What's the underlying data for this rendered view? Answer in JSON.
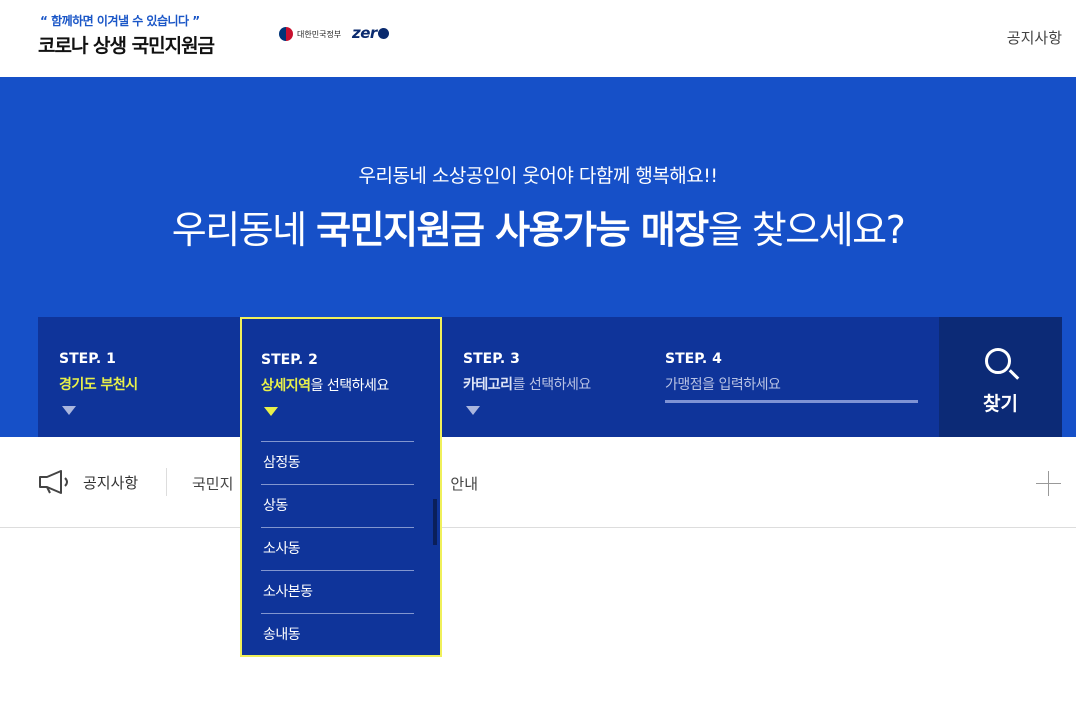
{
  "header": {
    "slogan": "“ 함께하면 이겨낼 수 있습니다 ”",
    "site_title": "코로나 상생 국민지원금",
    "gov_label": "대한민국정부",
    "zero_label": "zer",
    "notice_link": "공지사항"
  },
  "hero": {
    "subtitle": "우리동네 소상공인이 웃어야 다함께 행복해요!!",
    "title_prefix": "우리동네 ",
    "title_bold": "국민지원금 사용가능 매장",
    "title_suffix": "을 찾으세요?"
  },
  "search": {
    "step1": {
      "label": "STEP. 1",
      "value": "경기도 부천시"
    },
    "step2": {
      "label": "STEP. 2",
      "value_highlight": "상세지역",
      "value_rest": "을 선택하세요"
    },
    "step3": {
      "label": "STEP. 3",
      "value_bold": "카테고리",
      "value_rest": "를 선택하세요"
    },
    "step4": {
      "label": "STEP. 4",
      "placeholder": "가맹점을 입력하세요"
    },
    "find_button": "찾기",
    "district_options": [
      "삼정동",
      "상동",
      "소사동",
      "소사본동",
      "송내동"
    ]
  },
  "notice_bar": {
    "title": "공지사항",
    "text_visible_left": "국민지",
    "text_visible_right": "안내"
  },
  "colors": {
    "hero_bg": "#1650c8",
    "steps_bg": "#0f349a",
    "find_bg": "#0c2a76",
    "highlight": "#e8f04a"
  },
  "icons": [
    "search-icon",
    "megaphone-icon",
    "plus-icon",
    "chevron-down-icon"
  ]
}
